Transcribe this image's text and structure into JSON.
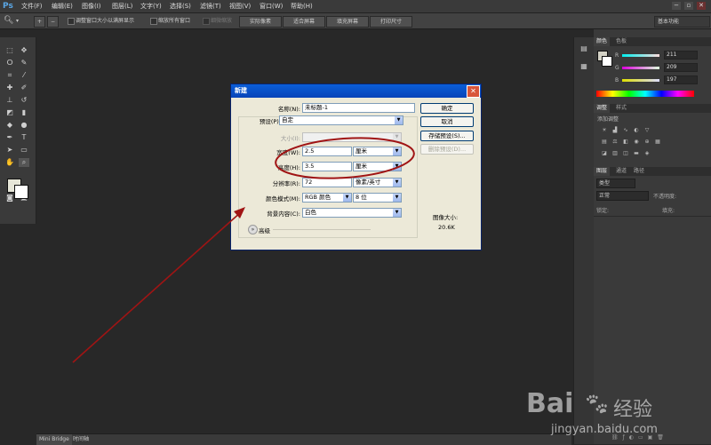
{
  "app": {
    "logo": "Ps"
  },
  "menubar": {
    "items": [
      "文件(F)",
      "编辑(E)",
      "图像(I)",
      "图层(L)",
      "文字(Y)",
      "选择(S)",
      "滤镜(T)",
      "视图(V)",
      "窗口(W)",
      "帮助(H)"
    ],
    "window_buttons": [
      "−",
      "▫",
      "✕"
    ]
  },
  "options_bar": {
    "resize_windows": "调整窗口大小以满屏显示",
    "zoom_all": "缩放所有窗口",
    "scrubby_zoom": "细微缩放",
    "actual_pixels": "实际像素",
    "fit_screen": "适合屏幕",
    "fill_screen": "填充屏幕",
    "print_size": "打印尺寸",
    "workspace": "基本功能"
  },
  "bottom_tabs": [
    "Mini Bridge",
    "时间轴"
  ],
  "color_panel": {
    "tabs": [
      "颜色",
      "色板"
    ],
    "r_label": "R",
    "r_value": "211",
    "g_label": "G",
    "g_value": "209",
    "b_label": "B",
    "b_value": "197",
    "fg_color": "#d3d1c5"
  },
  "adjustments_panel": {
    "tabs": [
      "调整",
      "样式"
    ],
    "add_label": "添加调整"
  },
  "layers_panel": {
    "tabs": [
      "图层",
      "通道",
      "路径"
    ],
    "kind": "类型",
    "blend": "正常",
    "opacity": "不透明度:",
    "lock": "锁定:",
    "fill": "填充:"
  },
  "dialog": {
    "title": "新建",
    "name_label": "名称(N):",
    "name_value": "未标题-1",
    "preset_label": "预设(P):",
    "preset_value": "自定",
    "size_label": "大小(I):",
    "width_label": "宽度(W):",
    "width_value": "2.5",
    "width_unit": "厘米",
    "height_label": "高度(H):",
    "height_value": "3.5",
    "height_unit": "厘米",
    "resolution_label": "分辨率(R):",
    "resolution_value": "72",
    "resolution_unit": "像素/英寸",
    "color_mode_label": "颜色模式(M):",
    "color_mode_value": "RGB 颜色",
    "bit_depth": "8 位",
    "bg_label": "背景内容(C):",
    "bg_value": "白色",
    "advanced": "高级",
    "ok": "确定",
    "cancel": "取消",
    "save_preset": "存储预设(S)...",
    "delete_preset": "删除预设(D)...",
    "image_size_label": "图像大小:",
    "image_size_value": "20.6K"
  },
  "watermark": {
    "brand": "Bai",
    "suffix": "经验",
    "url": "jingyan.baidu.com"
  },
  "colors": {
    "annotation": "#a01414",
    "dialog_title": "#0a5fd8"
  }
}
